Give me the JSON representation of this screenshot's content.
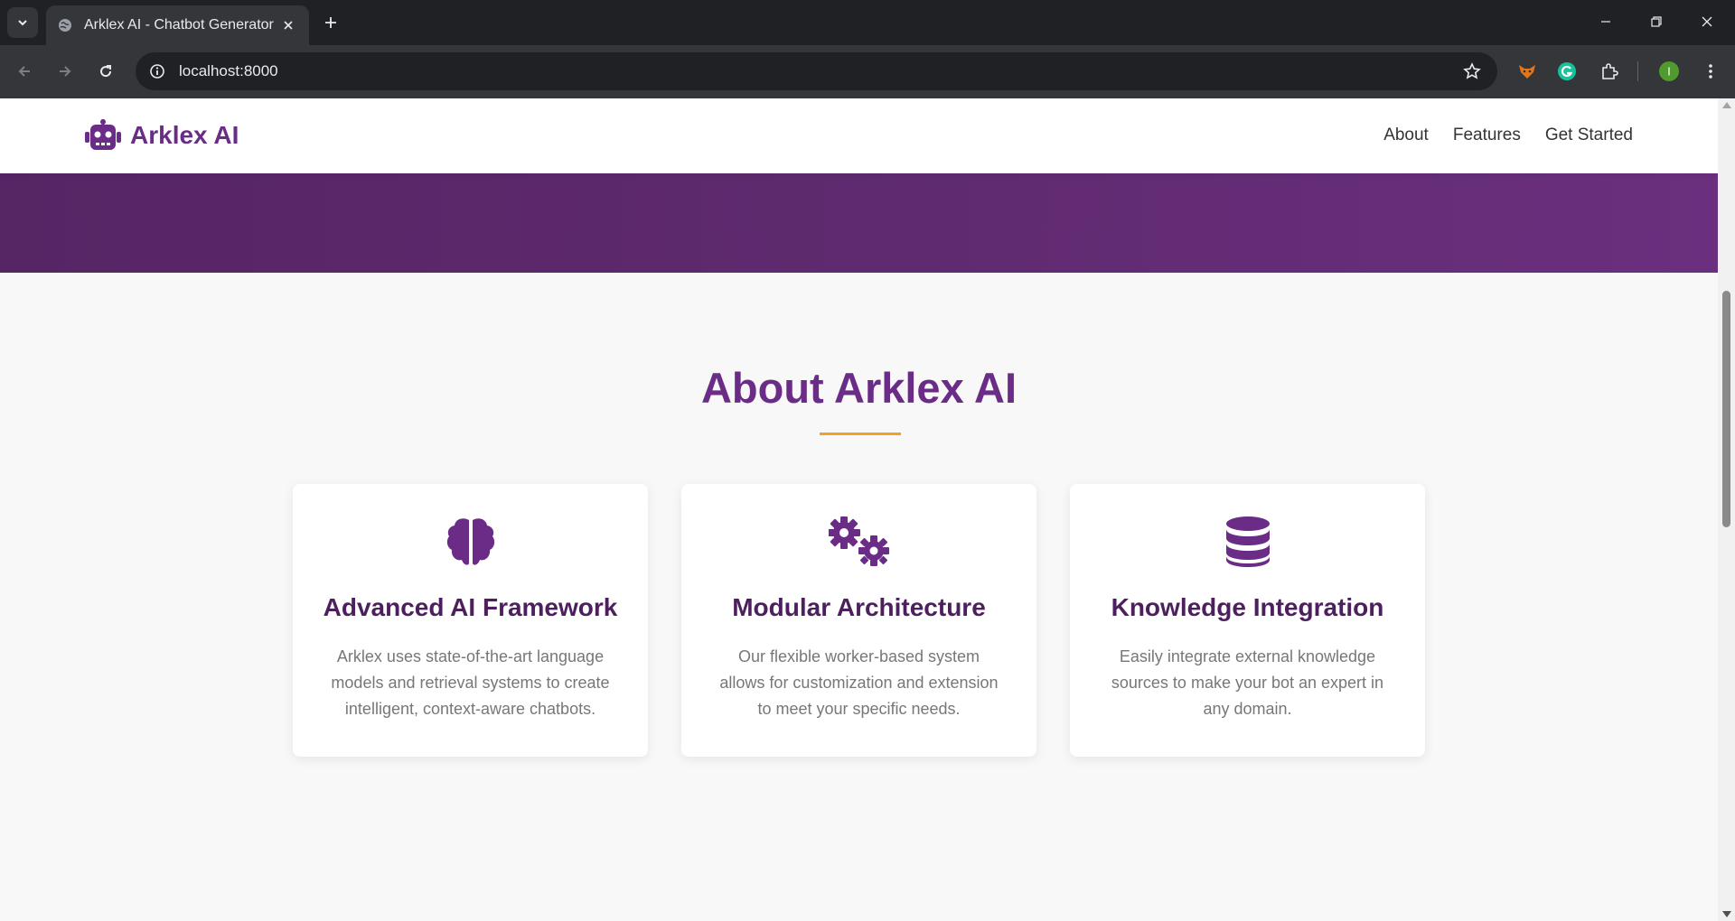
{
  "browser": {
    "tab_title": "Arklex AI - Chatbot Generator",
    "url": "localhost:8000",
    "profile_initial": "I",
    "icons": {
      "tab_search": "chevron-down-icon",
      "favicon": "globe-icon",
      "close": "close-icon",
      "new_tab": "plus-icon",
      "back": "arrow-left-icon",
      "forward": "arrow-right-icon",
      "reload": "reload-icon",
      "site_info": "info-icon",
      "bookmark": "star-icon",
      "extensions": [
        "fox-extension-icon",
        "grammarly-icon",
        "puzzle-icon"
      ],
      "menu": "kebab-menu-icon"
    }
  },
  "site": {
    "brand": "Arklex AI",
    "nav": [
      "About",
      "Features",
      "Get Started"
    ],
    "colors": {
      "brand": "#6a2c86",
      "hero": "#5f2a6f",
      "accent": "#f0a223"
    }
  },
  "about": {
    "title": "About Arklex AI",
    "cards": [
      {
        "icon": "brain-icon",
        "title": "Advanced AI Framework",
        "text": "Arklex uses state-of-the-art language models and retrieval systems to create intelligent, context-aware chatbots."
      },
      {
        "icon": "gears-icon",
        "title": "Modular Architecture",
        "text": "Our flexible worker-based system allows for customization and extension to meet your specific needs."
      },
      {
        "icon": "database-icon",
        "title": "Knowledge Integration",
        "text": "Easily integrate external knowledge sources to make your bot an expert in any domain."
      }
    ]
  }
}
